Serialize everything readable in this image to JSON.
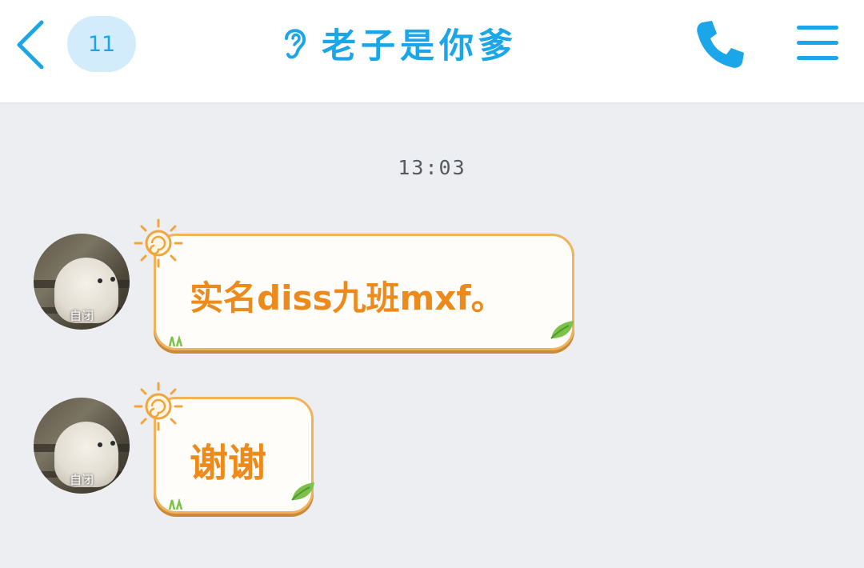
{
  "header": {
    "back_icon": "chevron-left-icon",
    "unread_count": "11",
    "contact_icon": "ear-icon",
    "title": "老子是你爹",
    "call_icon": "phone-icon",
    "menu_icon": "hamburger-menu-icon"
  },
  "chat": {
    "timestamp": "13:03",
    "messages": [
      {
        "avatar_label": "自闭",
        "text": "实名diss九班mxf。"
      },
      {
        "avatar_label": "自闭",
        "text": "谢谢"
      }
    ]
  },
  "colors": {
    "accent": "#1aa6e8",
    "badge_bg": "#d3ecfb",
    "bubble_border": "#f0b25a",
    "bubble_text": "#ec8a1c",
    "chat_bg": "#eceef1"
  }
}
